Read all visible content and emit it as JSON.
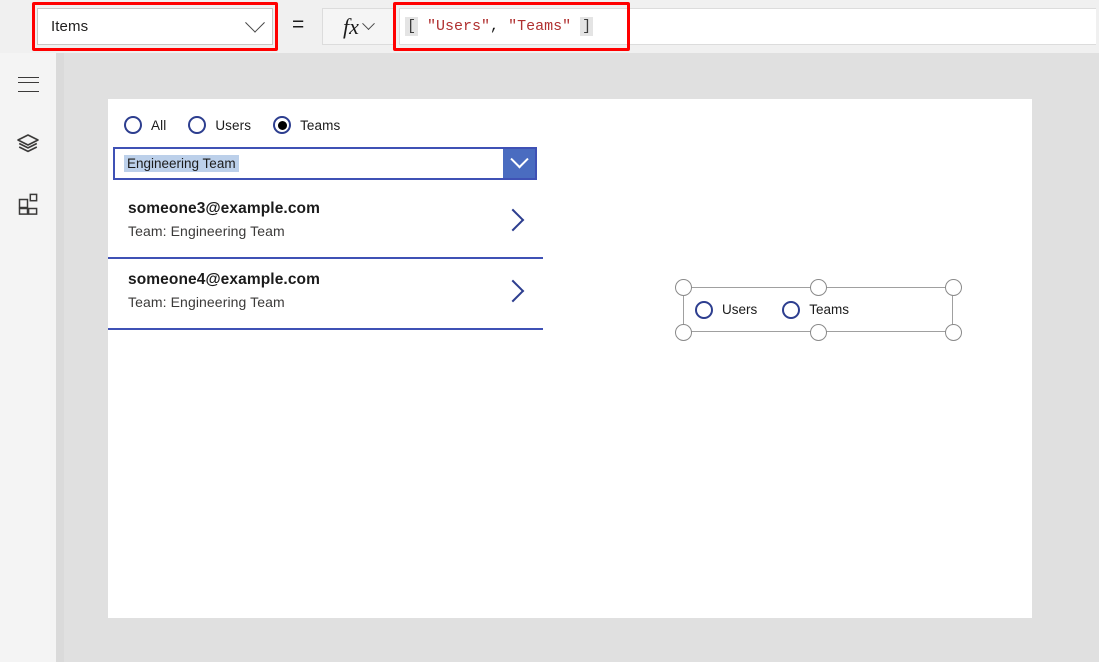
{
  "formula_bar": {
    "property_dropdown": {
      "value": "Items",
      "chevron_icon": "chevron-down-icon"
    },
    "equals": "=",
    "fx_button": {
      "label": "fx",
      "chevron_icon": "chevron-down-icon"
    },
    "formula": {
      "open_bracket": "[",
      "space_1": " ",
      "string_1": "\"Users\"",
      "comma": ",",
      "space_2": " ",
      "string_2": "\"Teams\"",
      "space_3": " ",
      "close_bracket": "]",
      "full_text": "[ \"Users\", \"Teams\" ]"
    },
    "annotation_color": "#ff0000"
  },
  "left_rail": {
    "items": [
      {
        "name": "hamburger-menu",
        "icon": "hamburger-icon"
      },
      {
        "name": "tree-view",
        "icon": "layers-icon"
      },
      {
        "name": "insert",
        "icon": "grid-insert-icon"
      }
    ]
  },
  "app_canvas": {
    "radio_group": {
      "options": [
        {
          "label": "All",
          "selected": false
        },
        {
          "label": "Users",
          "selected": false
        },
        {
          "label": "Teams",
          "selected": true
        }
      ]
    },
    "dropdown": {
      "selected_value": "Engineering Team",
      "chevron_icon": "chevron-down-icon"
    },
    "gallery": {
      "items": [
        {
          "title": "someone3@example.com",
          "subtitle": "Team: Engineering Team",
          "chevron_icon": "chevron-right-icon"
        },
        {
          "title": "someone4@example.com",
          "subtitle": "Team: Engineering Team",
          "chevron_icon": "chevron-right-icon"
        }
      ]
    }
  },
  "selected_control": {
    "type": "radio-group",
    "options": [
      {
        "label": "Users",
        "selected": false
      },
      {
        "label": "Teams",
        "selected": false
      }
    ],
    "handles": [
      "top-left",
      "top-middle",
      "top-right",
      "bottom-left",
      "bottom-middle",
      "bottom-right"
    ]
  },
  "colors": {
    "accent_blue": "#3f51b5",
    "radio_blue": "#2d3e8f",
    "dropdown_button_blue": "#4a6cc0",
    "selection_highlight": "#bcd0ea",
    "annotation_red": "#ff0000",
    "workspace_gray": "#e0e0e0",
    "rail_gray": "#f4f4f4",
    "formula_bar_gray": "#f0f0f0"
  }
}
